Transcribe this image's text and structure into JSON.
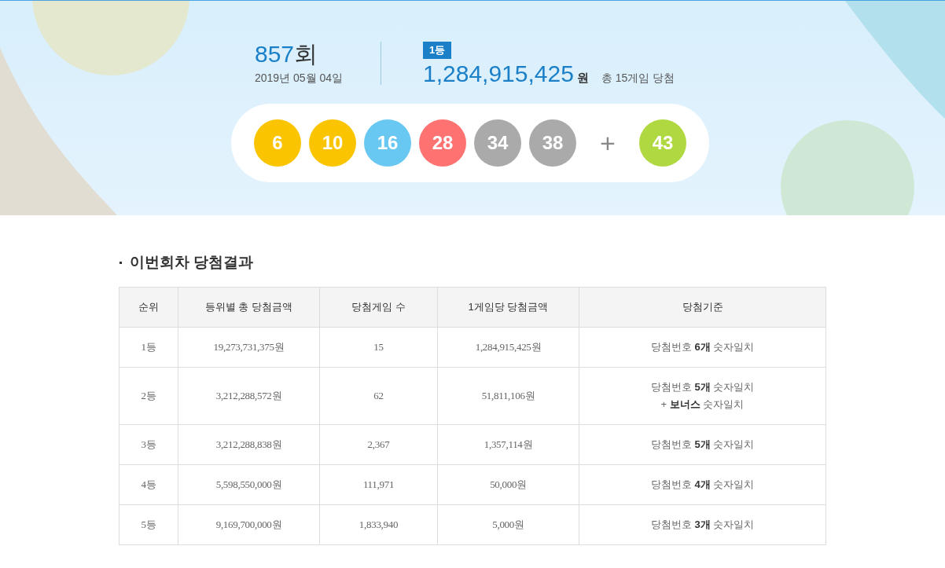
{
  "draw": {
    "number": "857",
    "unit": "회",
    "date": "2019년 05월 04일"
  },
  "first_prize": {
    "badge": "1등",
    "amount": "1,284,915,425",
    "currency": "원",
    "summary": "총 15게임 당첨"
  },
  "balls": [
    {
      "number": "6",
      "color": "#fbc400"
    },
    {
      "number": "10",
      "color": "#fbc400"
    },
    {
      "number": "16",
      "color": "#69c8f2"
    },
    {
      "number": "28",
      "color": "#ff7272"
    },
    {
      "number": "34",
      "color": "#aaaaaa"
    },
    {
      "number": "38",
      "color": "#aaaaaa"
    }
  ],
  "plus": "+",
  "bonus_ball": {
    "number": "43",
    "color": "#b0d840"
  },
  "section_title": "이번회차 당첨결과",
  "table": {
    "columns": [
      "순위",
      "등위별 총 당첨금액",
      "당첨게임 수",
      "1게임당 당첨금액",
      "당첨기준"
    ],
    "rows": [
      {
        "rank": "1등",
        "total": "19,273,731,375원",
        "games": "15",
        "per_game": "1,284,915,425원",
        "criteria": [
          "당첨번호 **6개** 숫자일치"
        ]
      },
      {
        "rank": "2등",
        "total": "3,212,288,572원",
        "games": "62",
        "per_game": "51,811,106원",
        "criteria": [
          "당첨번호 **5개** 숫자일치",
          "+ **보너스** 숫자일치"
        ]
      },
      {
        "rank": "3등",
        "total": "3,212,288,838원",
        "games": "2,367",
        "per_game": "1,357,114원",
        "criteria": [
          "당첨번호 **5개** 숫자일치"
        ]
      },
      {
        "rank": "4등",
        "total": "5,598,550,000원",
        "games": "111,971",
        "per_game": "50,000원",
        "criteria": [
          "당첨번호 **4개** 숫자일치"
        ]
      },
      {
        "rank": "5등",
        "total": "9,169,700,000원",
        "games": "1,833,940",
        "per_game": "5,000원",
        "criteria": [
          "당첨번호 **3개** 숫자일치"
        ]
      }
    ]
  }
}
